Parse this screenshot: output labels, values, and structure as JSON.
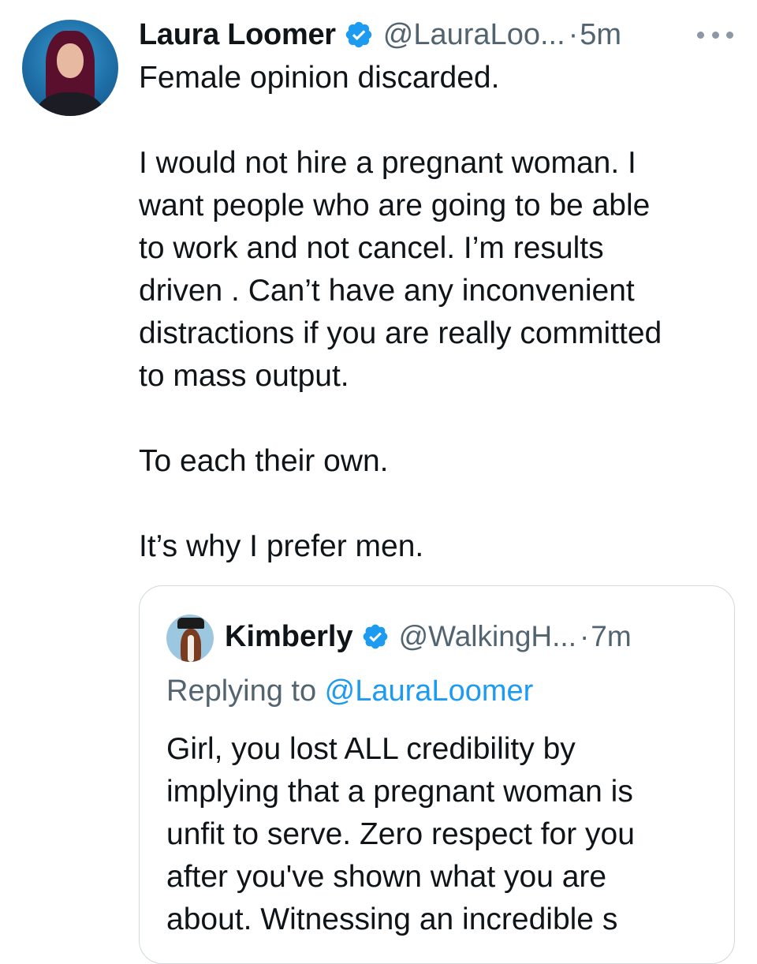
{
  "tweet": {
    "author": {
      "name": "Laura Loomer",
      "handle": "@LauraLoo...",
      "separator": "·",
      "time": "5m",
      "verified": true,
      "avatar_icon": "profile-photo-woman"
    },
    "more_icon": "more-horizontal-icon",
    "body": {
      "line1": "Female opinion discarded.",
      "paragraph2": "I would not hire a pregnant woman. I\nwant people who are going to be able\nto work and not cancel. I’m results\ndriven . Can’t have any inconvenient\ndistractions if you are really committed\nto mass output.",
      "paragraph3": "To each their own.",
      "paragraph4": "It’s why I prefer men."
    }
  },
  "quoted": {
    "author": {
      "name": "Kimberly",
      "handle": "@WalkingH...",
      "separator": "·",
      "time": "7m",
      "verified": true,
      "avatar_icon": "horse-with-hat-avatar"
    },
    "replying_prefix": "Replying to ",
    "replying_mention": "@LauraLoomer",
    "text": "Girl, you lost ALL credibility by\nimplying that a pregnant woman is\nunfit to serve. Zero respect for you\nafter you've shown what you are\nabout. Witnessing an incredible s"
  },
  "colors": {
    "text_primary": "#0f1419",
    "text_secondary": "#536471",
    "link": "#1d9bf0",
    "verified_badge": "#1d9bf0",
    "border": "#cfd9de"
  }
}
